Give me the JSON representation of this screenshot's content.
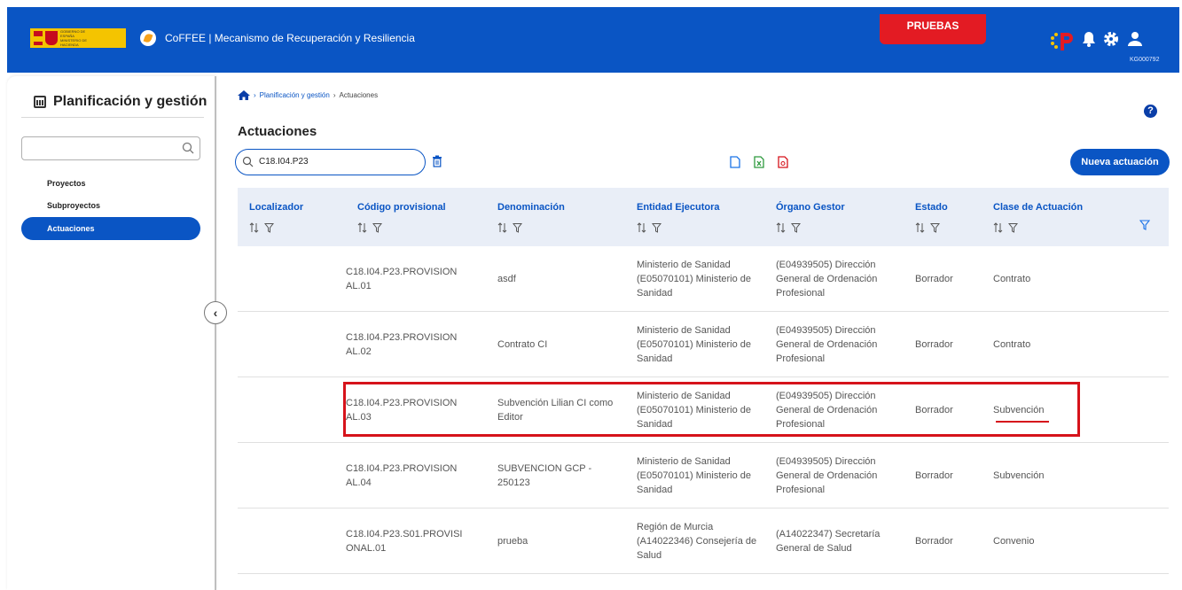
{
  "header": {
    "gov_logo_text": "GOBIERNO DE ESPAÑA  MINISTERIO DE HACIENDA",
    "app_title": "CoFFEE  |  Mecanismo de Recuperación y Resiliencia",
    "env_badge": "PRUEBAS",
    "user_code": "KG000792",
    "colors": {
      "header_bg": "#0a55c4",
      "badge": "#e31b23"
    }
  },
  "sidebar": {
    "title": "Planificación y gestión",
    "search_placeholder": "",
    "items": [
      {
        "label": "Proyectos",
        "active": false
      },
      {
        "label": "Subproyectos",
        "active": false
      },
      {
        "label": "Actuaciones",
        "active": true
      }
    ],
    "collapse_icon": "chevron-left-icon"
  },
  "breadcrumb": {
    "home_icon": "home-icon",
    "items": [
      "Planificación y gestión",
      "Actuaciones"
    ]
  },
  "page": {
    "title": "Actuaciones",
    "search_value": "C18.I04.P23",
    "new_button": "Nueva actuación"
  },
  "table": {
    "headers": [
      "Localizador",
      "Código provisional",
      "Denominación",
      "Entidad Ejecutora",
      "Órgano Gestor",
      "Estado",
      "Clase de Actuación"
    ],
    "rows": [
      {
        "localizador": "",
        "codigo": "C18.I04.P23.PROVISION AL.01",
        "denominacion": "asdf",
        "entidad": "Ministerio de Sanidad (E05070101) Ministerio de Sanidad",
        "organo": "(E04939505) Dirección General de Ordenación Profesional",
        "estado": "Borrador",
        "clase": "Contrato"
      },
      {
        "localizador": "",
        "codigo": "C18.I04.P23.PROVISION AL.02",
        "denominacion": "Contrato CI",
        "entidad": "Ministerio de Sanidad (E05070101) Ministerio de Sanidad",
        "organo": "(E04939505) Dirección General de Ordenación Profesional",
        "estado": "Borrador",
        "clase": "Contrato"
      },
      {
        "localizador": "",
        "codigo": "C18.I04.P23.PROVISION AL.03",
        "denominacion": "Subvención Lilian CI como Editor",
        "entidad": "Ministerio de Sanidad (E05070101) Ministerio de Sanidad",
        "organo": "(E04939505) Dirección General de Ordenación Profesional",
        "estado": "Borrador",
        "clase": "Subvención"
      },
      {
        "localizador": "",
        "codigo": "C18.I04.P23.PROVISION AL.04",
        "denominacion": "SUBVENCION GCP - 250123",
        "entidad": "Ministerio de Sanidad (E05070101) Ministerio de Sanidad",
        "organo": "(E04939505) Dirección General de Ordenación Profesional",
        "estado": "Borrador",
        "clase": "Subvención"
      },
      {
        "localizador": "",
        "codigo": "C18.I04.P23.S01.PROVISI ONAL.01",
        "denominacion": "prueba",
        "entidad": "Región de Murcia (A14022346) Consejería de Salud",
        "organo": "(A14022347) Secretaría General de Salud",
        "estado": "Borrador",
        "clase": "Convenio"
      }
    ]
  }
}
